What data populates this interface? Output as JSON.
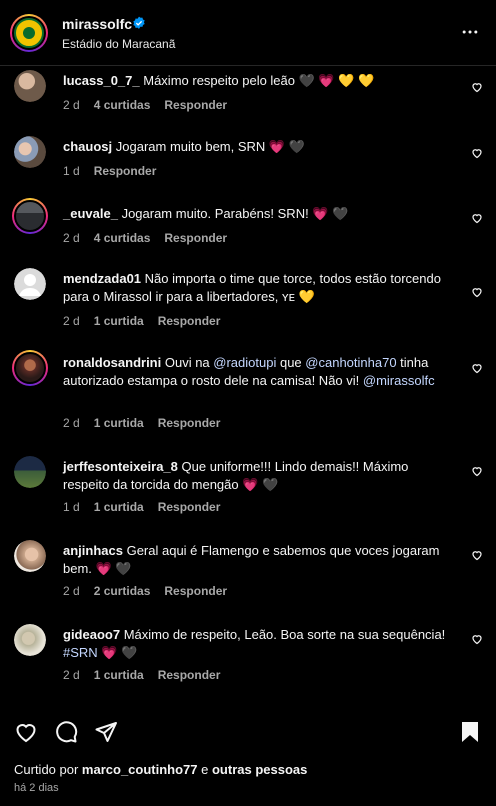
{
  "header": {
    "username": "mirassolfc",
    "location": "Estádio do Maracanã"
  },
  "comments": [
    {
      "user": "lucass_0_7_",
      "text": "Máximo respeito pelo leão 🖤 💗 💛 💛",
      "time": "2 d",
      "likes": "4 curtidas",
      "reply": "Responder",
      "avatar_color": "#6e5a4a"
    },
    {
      "user": "chauosj",
      "text": "Jogaram muito bem, SRN 💗 🖤",
      "time": "1 d",
      "likes": "",
      "reply": "Responder",
      "avatar_color": "#8a9bb5"
    },
    {
      "user": "_euvale_",
      "text": "Jogaram muito. Parabéns! SRN! 💗 🖤",
      "time": "2 d",
      "likes": "4 curtidas",
      "reply": "Responder",
      "avatar_color": "#3c3f44"
    },
    {
      "user": "mendzada01",
      "text": "Não importa o time que torce, todos estão torcendo para o Mirassol ir para a libertadores, ʏᴇ 💛",
      "time": "2 d",
      "likes": "1 curtida",
      "reply": "Responder",
      "avatar_color": "#dbdbdb"
    },
    {
      "user": "ronaldosandrini",
      "text_before": "Ouvi na ",
      "mention1": "@radiotupi",
      "text_mid": " que ",
      "mention2": "@canhotinha70",
      "text_after": " tinha autorizado estampa o rosto dele na camisa! Não vi! ",
      "mention3": "@mirassolfc",
      "time": "2 d",
      "likes": "1 curtida",
      "reply": "Responder",
      "avatar_color": "#5a2a24"
    },
    {
      "user": "jerffesonteixeira_8",
      "text": "Que uniforme!!! Lindo demais!! Máximo respeito da torcida do mengão 💗 🖤",
      "time": "1 d",
      "likes": "1 curtida",
      "reply": "Responder",
      "avatar_color": "#3b5c3a"
    },
    {
      "user": "anjinhacs",
      "text": "Geral aqui é Flamengo e sabemos que voces jogaram bem. 💗 🖤",
      "time": "2 d",
      "likes": "2 curtidas",
      "reply": "Responder",
      "avatar_color": "#c9a58a"
    },
    {
      "user": "gideaoo7",
      "text_before": "Máximo de respeito, Leão. Boa sorte na sua sequência! ",
      "mention1": "#SRN",
      "text_after": " 💗 🖤",
      "time": "2 d",
      "likes": "1 curtida",
      "reply": "Responder",
      "avatar_color": "#b7b39a"
    }
  ],
  "footer": {
    "liked_prefix": "Curtido por ",
    "liked_user": "marco_coutinho77",
    "liked_and": " e ",
    "liked_others": "outras pessoas",
    "time_ago": "há 2 dias"
  },
  "colors": {
    "background": "#000000",
    "mention": "#c4d7ff",
    "verified": "#0095f6",
    "meta": "#a8a8a8"
  },
  "icons": [
    "verified-badge-icon",
    "more-options-icon",
    "heart-icon",
    "comment-icon",
    "share-icon",
    "bookmark-icon"
  ]
}
